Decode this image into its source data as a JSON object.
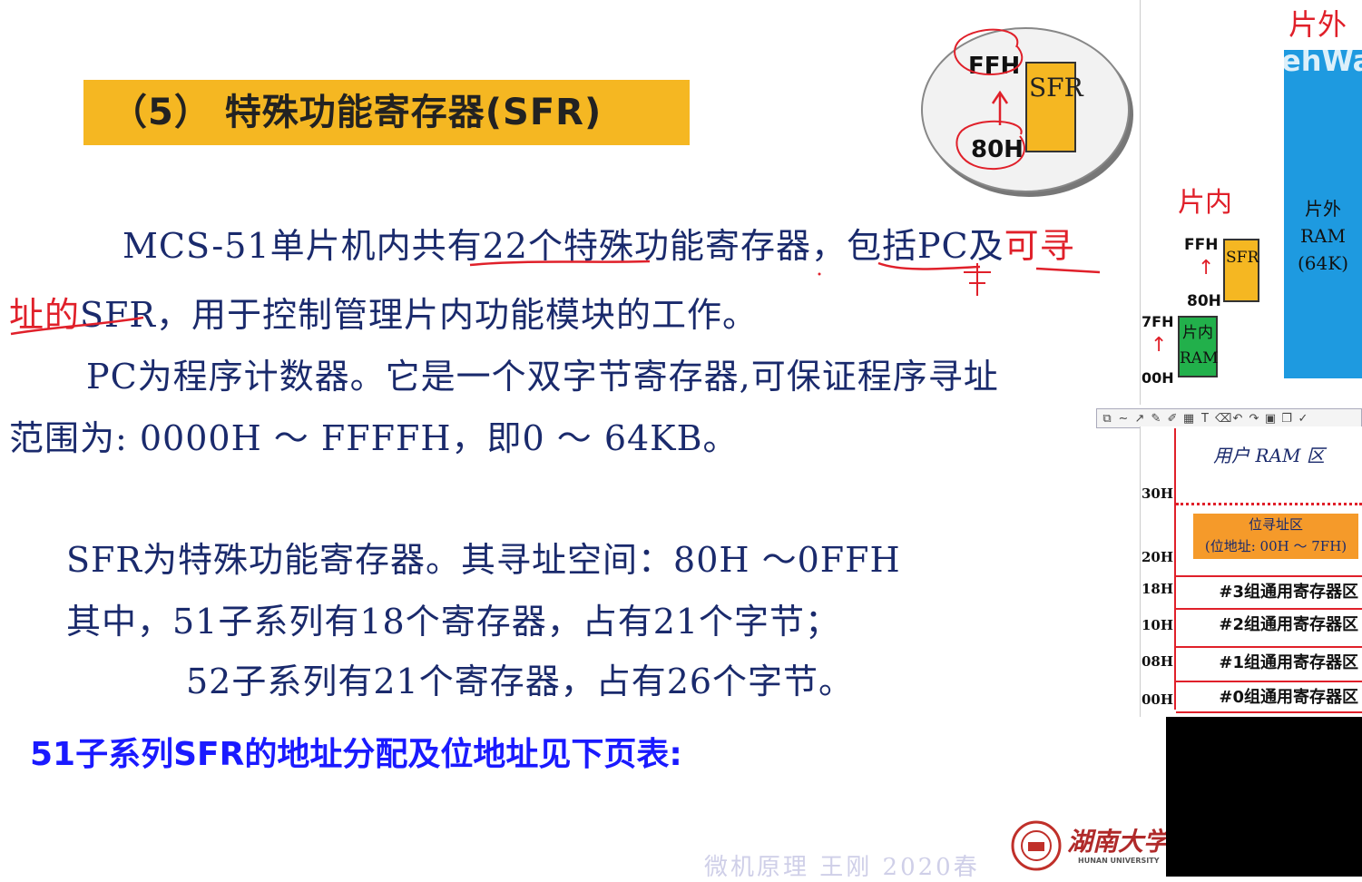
{
  "slide": {
    "title": "（5）  特殊功能寄存器(SFR)",
    "para1_line1_a": "MCS-51单片机内共有22个特殊功能寄存器，包括PC及",
    "para1_line1_red": "可寻",
    "para1_line2_red": "址的",
    "para1_line2_b": "SFR，用于控制管理片内功能模块的工作。",
    "para2_line1": "PC为程序计数器。它是一个双字节寄存器,可保证程序寻址",
    "para2_line2": "范围为: 0000H ～ FFFFH，即0 ～ 64KB。",
    "para3_line1": "SFR为特殊功能寄存器。其寻址空间：80H ～0FFH",
    "para3_line2": "其中，51子系列有18个寄存器，占有21个字节；",
    "para3_line3": "52子系列有21个寄存器，占有26个字节。",
    "bottom_note": "51子系列SFR的地址分配及位地址见下页表:",
    "footer": "微机原理   王刚   2020春"
  },
  "diagram": {
    "ffh": "FFH",
    "h80": "80H",
    "sfr": "SFR"
  },
  "memory_panel": {
    "offchip_title": "片外",
    "watermark": "ehWa",
    "offchip_ram": "片外\nRAM\n(64K)",
    "offchip_ram_l1": "片外",
    "offchip_ram_l2": "RAM",
    "offchip_ram_l3": "(64K)",
    "onchip_title": "片内",
    "ffh": "FFH",
    "h80": "80H",
    "sfr": "SFR",
    "h7f": "7FH",
    "h00": "00H",
    "onchip_ram_l1": "片内",
    "onchip_ram_l2": "RAM"
  },
  "toolbar": {
    "icons": [
      "rect-select-icon",
      "curve-icon",
      "line-icon",
      "pen-icon",
      "highlighter-icon",
      "grid-icon",
      "text-icon",
      "eraser-icon",
      "undo-icon",
      "redo-icon",
      "save-icon",
      "copy-icon",
      "check-icon"
    ],
    "glyphs": [
      "⧉",
      "∼",
      "↗",
      "✎",
      "✐",
      "▦",
      "T",
      "⌫",
      "↶",
      "↷",
      "▣",
      "❐",
      "✓"
    ]
  },
  "ram_map": {
    "user_area": "用户 RAM 区",
    "bit_area_l1": "位寻址区",
    "bit_area_l2": "(位地址: 00H ～ 7FH)",
    "addr_30": "30H",
    "addr_20": "20H",
    "addr_18": "18H",
    "addr_10": "10H",
    "addr_08": "08H",
    "addr_00": "00H",
    "reg3": "#3组通用寄存器区",
    "reg2": "#2组通用寄存器区",
    "reg1": "#1组通用寄存器区",
    "reg0": "#0组通用寄存器区"
  },
  "logo": {
    "name": "湖南大学",
    "sub": "HUNAN UNIVERSITY"
  },
  "colors": {
    "title_bg": "#f5b722",
    "text_navy": "#1a2a6c",
    "annotation_red": "#e0202a",
    "note_blue": "#1a1aff",
    "ram_blue": "#1e9ae0",
    "sfr_orange": "#f5b722",
    "ram_green": "#22b04b"
  }
}
